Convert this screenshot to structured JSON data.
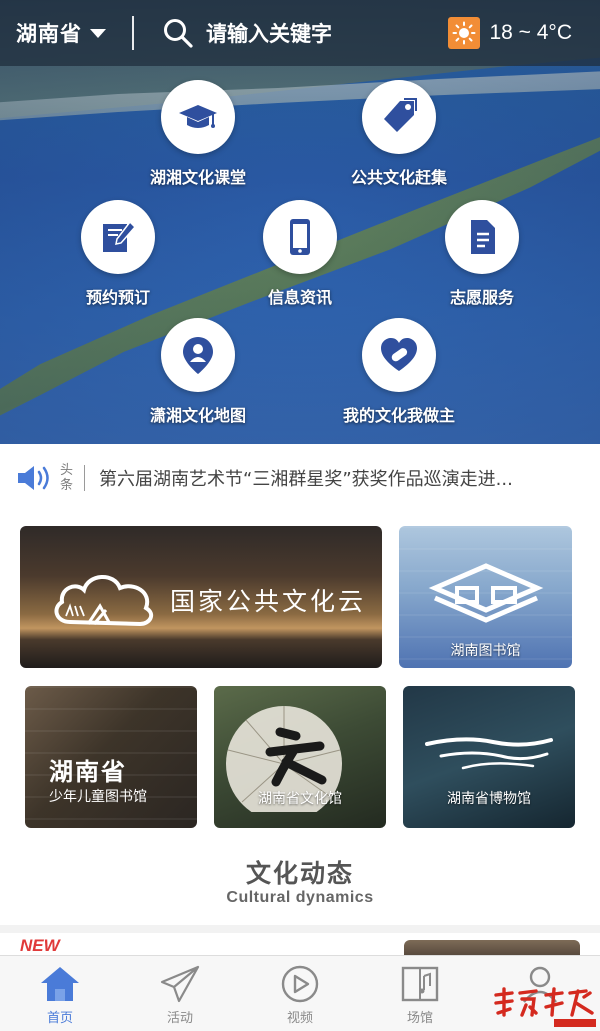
{
  "header": {
    "region": "湖南省",
    "search_placeholder": "请输入关键字",
    "weather": "18 ~ 4°C"
  },
  "menu": [
    {
      "label": "湖湘文化课堂",
      "icon": "graduation-cap-icon"
    },
    {
      "label": "公共文化赶集",
      "icon": "price-tag-icon"
    },
    {
      "label": "预约预订",
      "icon": "book-pen-icon"
    },
    {
      "label": "信息资讯",
      "icon": "smartphone-icon"
    },
    {
      "label": "志愿服务",
      "icon": "document-icon"
    },
    {
      "label": "潇湘文化地图",
      "icon": "map-pin-person-icon"
    },
    {
      "label": "我的文化我做主",
      "icon": "heart-bandage-icon"
    }
  ],
  "ticker": {
    "tag_top": "头",
    "tag_bottom": "条",
    "text": "第六届湖南艺术节“三湘群星奖”获奖作品巡演走进..."
  },
  "cards": {
    "cloud": {
      "title": "国家公共文化云"
    },
    "library": {
      "caption": "湖南图书馆"
    },
    "youth_library": {
      "title": "湖南省",
      "caption": "少年儿童图书馆"
    },
    "culture_hall": {
      "caption": "湖南省文化馆"
    },
    "museum": {
      "caption": "湖南省博物馆"
    }
  },
  "section": {
    "title": "文化动态",
    "subtitle": "Cultural dynamics",
    "badge": "NEW"
  },
  "tabs": [
    {
      "label": "首页",
      "icon": "home-icon",
      "active": true
    },
    {
      "label": "活动",
      "icon": "paper-plane-icon",
      "active": false
    },
    {
      "label": "视频",
      "icon": "play-circle-icon",
      "active": false
    },
    {
      "label": "场馆",
      "icon": "music-book-icon",
      "active": false
    },
    {
      "label": "我的",
      "icon": "user-icon",
      "active": false
    }
  ],
  "colors": {
    "accent": "#4a7bd8",
    "menu_icon": "#2f4f9e",
    "weather_badge": "#f28d36",
    "news_badge": "#e03a3a"
  }
}
